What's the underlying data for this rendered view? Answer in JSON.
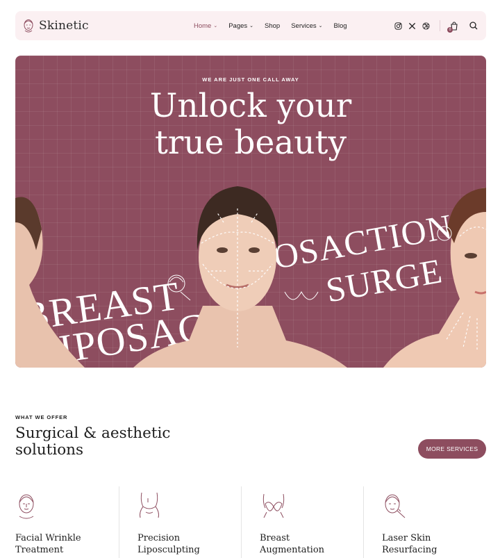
{
  "brand": {
    "name": "Skinetic",
    "accent": "#8d4d5f",
    "header_bg": "#fbf0f2"
  },
  "nav": {
    "items": [
      {
        "label": "Home",
        "has_dropdown": true,
        "active": true
      },
      {
        "label": "Pages",
        "has_dropdown": true
      },
      {
        "label": "Shop",
        "has_dropdown": false
      },
      {
        "label": "Services",
        "has_dropdown": true
      },
      {
        "label": "Blog",
        "has_dropdown": false
      }
    ],
    "chevron": "⌄"
  },
  "header_tools": {
    "social_icons": [
      "instagram-icon",
      "x-icon",
      "dribbble-icon"
    ],
    "cart_icon": "cart-icon",
    "cart_count": "0",
    "search_icon": "search-icon"
  },
  "hero": {
    "eyebrow": "WE ARE JUST ONE CALL AWAY",
    "title_line1": "Unlock your",
    "title_line2": "true beauty",
    "band_words": [
      "BREAST",
      "LIPOSACTI",
      "OSACTION",
      "SURGE"
    ]
  },
  "offer": {
    "eyebrow": "WHAT WE OFFER",
    "title_line1": "Surgical & aesthetic",
    "title_line2": "solutions",
    "more_button": "MORE SERVICES"
  },
  "services": [
    {
      "line1": "Facial Wrinkle",
      "line2": "Treatment",
      "icon": "face-icon"
    },
    {
      "line1": "Precision",
      "line2": "Liposculpting",
      "icon": "body-icon"
    },
    {
      "line1": "Breast",
      "line2": "Augmentation",
      "icon": "breast-icon"
    },
    {
      "line1": "Laser Skin",
      "line2": "Resurfacing",
      "icon": "laser-face-icon"
    }
  ]
}
